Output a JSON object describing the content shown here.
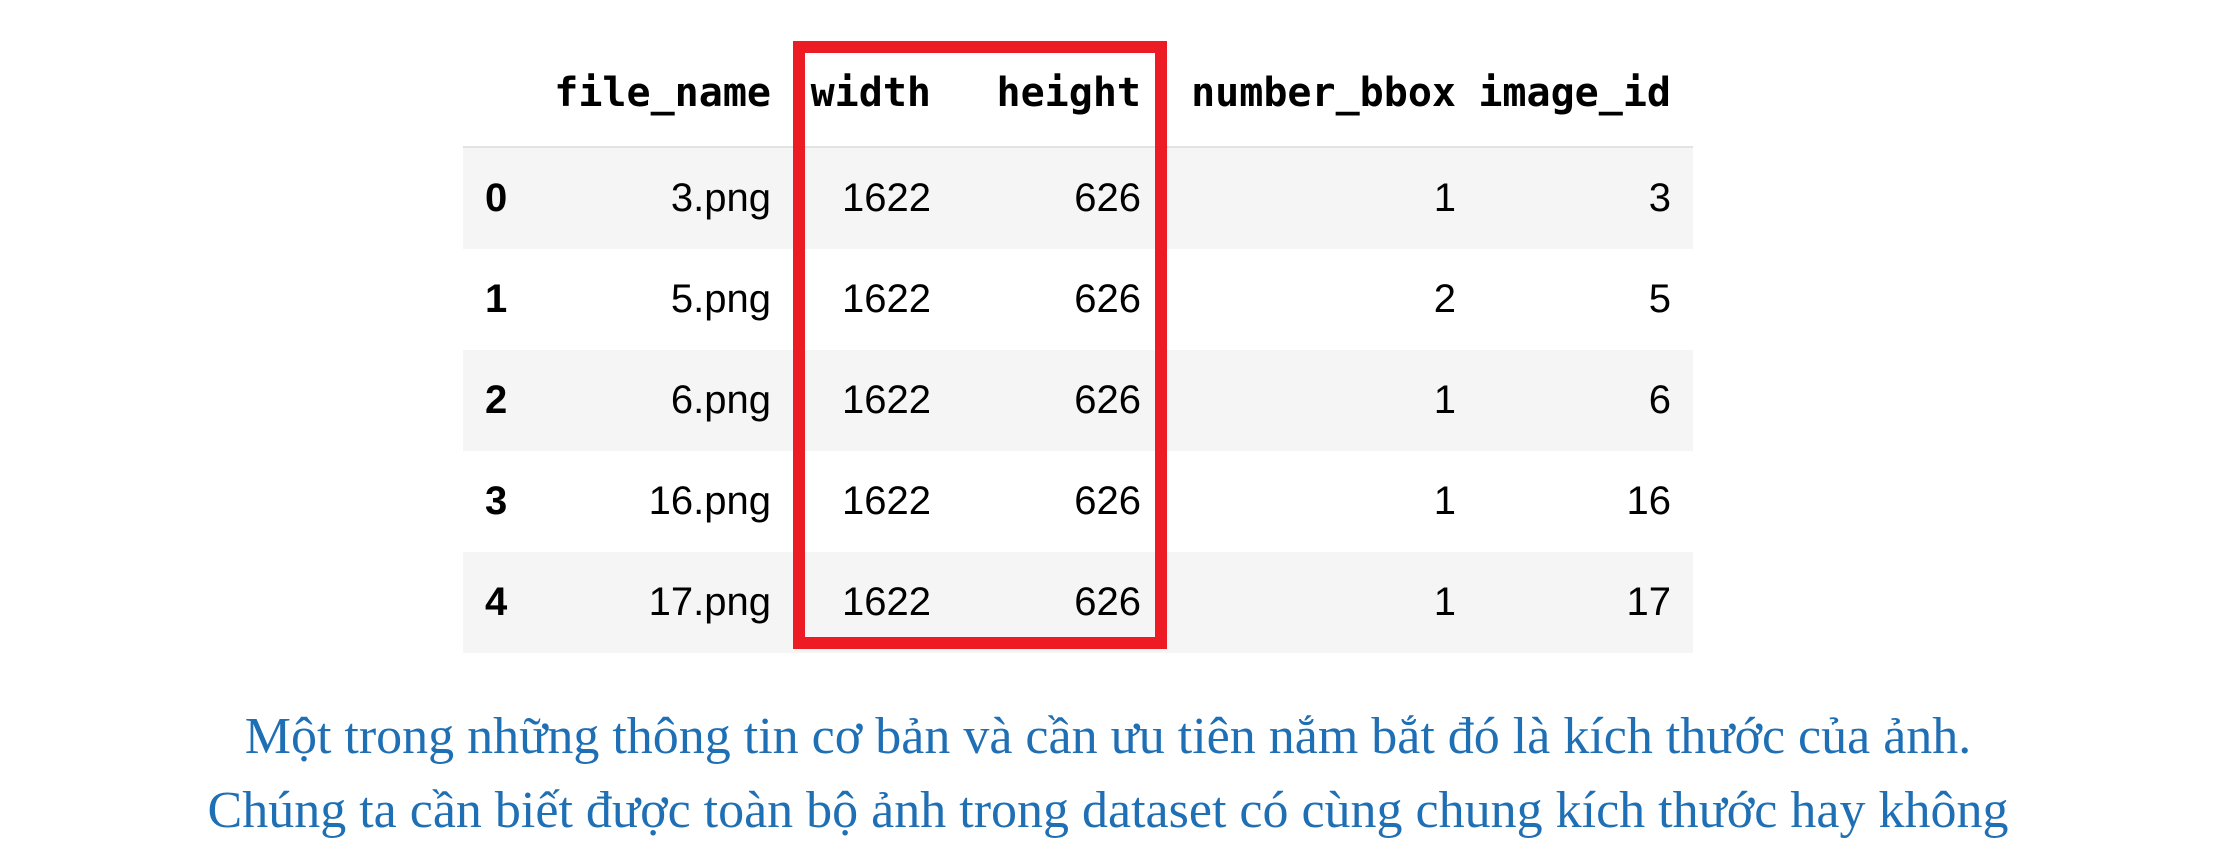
{
  "table": {
    "columns": [
      "file_name",
      "width",
      "height",
      "number_bbox",
      "image_id"
    ],
    "rows": [
      {
        "index": "0",
        "cells": [
          "3.png",
          "1622",
          "626",
          "1",
          "3"
        ]
      },
      {
        "index": "1",
        "cells": [
          "5.png",
          "1622",
          "626",
          "2",
          "5"
        ]
      },
      {
        "index": "2",
        "cells": [
          "6.png",
          "1622",
          "626",
          "1",
          "6"
        ]
      },
      {
        "index": "3",
        "cells": [
          "16.png",
          "1622",
          "626",
          "1",
          "16"
        ]
      },
      {
        "index": "4",
        "cells": [
          "17.png",
          "1622",
          "626",
          "1",
          "17"
        ]
      }
    ]
  },
  "highlight": {
    "color": "#ed1c24",
    "columns": [
      "width",
      "height"
    ]
  },
  "caption": {
    "line1": "Một trong những thông tin cơ bản và cần ưu tiên nắm bắt đó là kích thước của ảnh.",
    "line2": "Chúng ta cần biết được toàn bộ ảnh trong dataset có cùng chung kích thước hay không",
    "color": "#1f6fb5"
  }
}
